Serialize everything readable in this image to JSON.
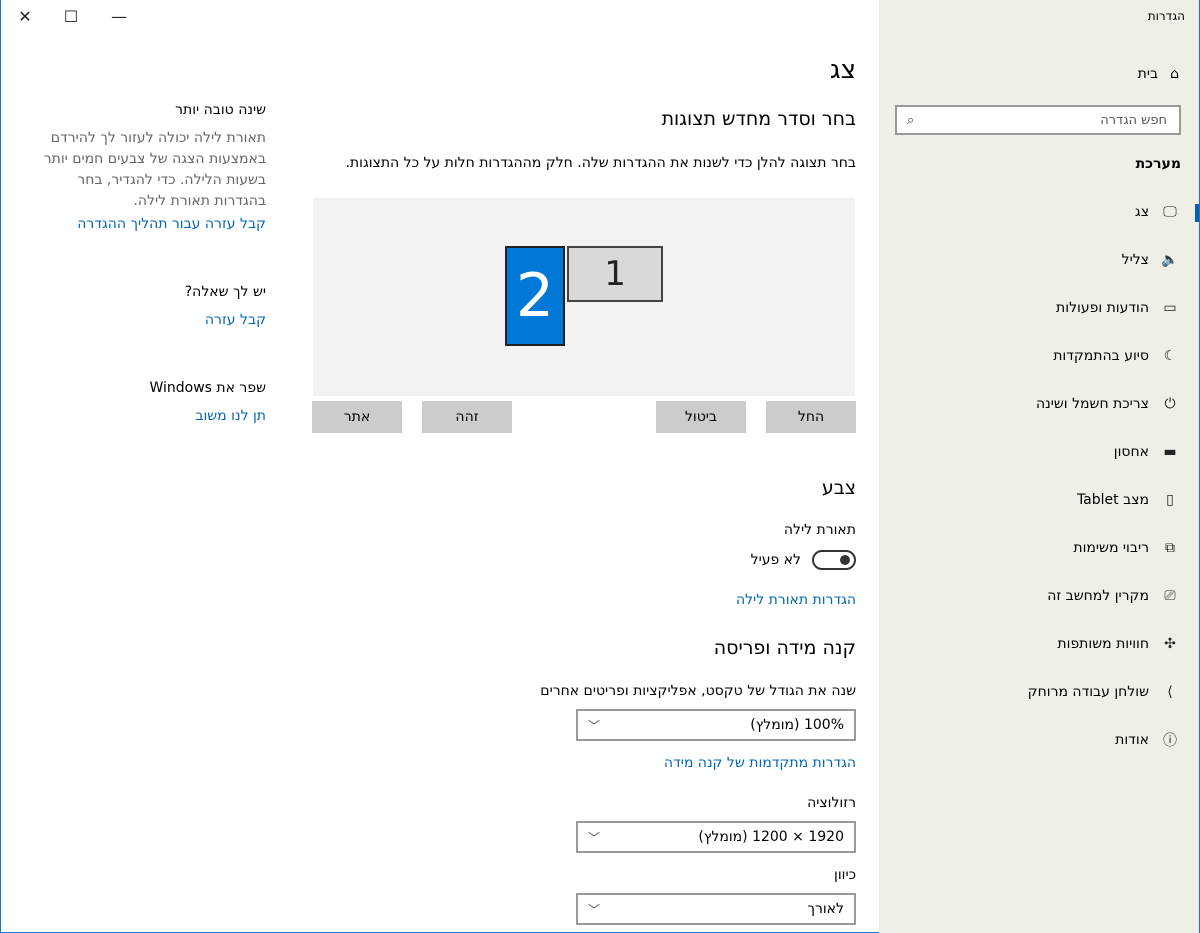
{
  "window": {
    "title": "הגדרות",
    "controls": {
      "close": "✕",
      "maximize": "☐",
      "minimize": "—"
    }
  },
  "sidebar": {
    "home": "בית",
    "search_placeholder": "חפש הגדרה",
    "section": "מערכת",
    "items": [
      {
        "label": "צג",
        "icon": "monitor-icon",
        "glyph": "🖵",
        "selected": true
      },
      {
        "label": "צליל",
        "icon": "speaker-icon",
        "glyph": "🔈"
      },
      {
        "label": "הודעות ופעולות",
        "icon": "notification-icon",
        "glyph": "▭"
      },
      {
        "label": "סיוע בהתמקדות",
        "icon": "moon-icon",
        "glyph": "☾"
      },
      {
        "label": "צריכת חשמל ושינה",
        "icon": "power-icon",
        "glyph": "⏻"
      },
      {
        "label": "אחסון",
        "icon": "storage-icon",
        "glyph": "▬"
      },
      {
        "label": "מצב Tablet",
        "icon": "tablet-icon",
        "glyph": "▯"
      },
      {
        "label": "ריבוי משימות",
        "icon": "multitasking-icon",
        "glyph": "⧉"
      },
      {
        "label": "מקרין למחשב זה",
        "icon": "projecting-icon",
        "glyph": "⎚"
      },
      {
        "label": "חוויות משותפות",
        "icon": "shared-experiences-icon",
        "glyph": "✣"
      },
      {
        "label": "שולחן עבודה מרוחק",
        "icon": "remote-desktop-icon",
        "glyph": "⟩"
      },
      {
        "label": "אודות",
        "icon": "about-icon",
        "glyph": "ⓘ"
      }
    ]
  },
  "main": {
    "title": "צג",
    "arrange_heading": "בחר וסדר מחדש תצוגות",
    "arrange_desc": "בחר תצוגה להלן כדי לשנות את ההגדרות שלה. חלק מההגדרות חלות על כל התצוגות.",
    "monitors": {
      "m1": "1",
      "m2": "2"
    },
    "buttons": {
      "apply": "החל",
      "cancel": "ביטול",
      "identify": "זהה",
      "detect": "אתר"
    },
    "color_heading": "צבע",
    "night_light_label": "תאורת לילה",
    "night_light_state": "לא פעיל",
    "night_light_settings": "הגדרות תאורת לילה",
    "scale_heading": "קנה מידה ופריסה",
    "scale_label": "שנה את הגודל של טקסט, אפליקציות ופריטים אחרים",
    "scale_value": "100% (מומלץ)",
    "advanced_scaling": "הגדרות מתקדמות של קנה מידה",
    "resolution_label": "רזולוציה",
    "resolution_value": "1920 × 1200 (מומלץ)",
    "orientation_label": "כיוון",
    "orientation_value": "לאורך"
  },
  "aside": {
    "sleep_title": "שינה טובה יותר",
    "sleep_desc": "תאורת לילה יכולה לעזור לך להירדם באמצעות הצגה של צבעים חמים יותר בשעות הלילה. כדי להגדיר, בחר בהגדרות תאורת לילה.",
    "sleep_link": "קבל עזרה עבור תהליך ההגדרה",
    "question_title": "יש לך שאלה?",
    "question_link": "קבל עזרה",
    "improve_title": "שפר את Windows",
    "improve_link": "תן לנו משוב"
  },
  "colors": {
    "accent": "#0078d7",
    "link": "#0066b4",
    "sidebar_bg": "#efefe8"
  }
}
